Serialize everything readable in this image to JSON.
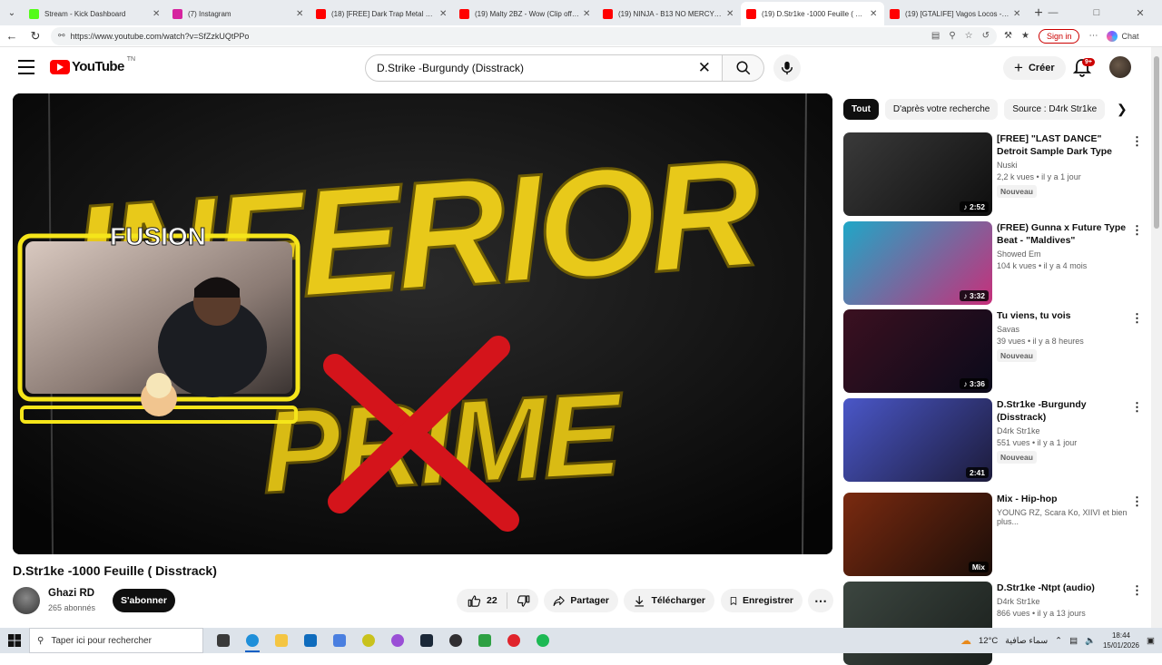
{
  "browser": {
    "tabs": [
      {
        "title": "Stream - Kick Dashboard",
        "favicon_color": "#53fc18",
        "active": false
      },
      {
        "title": "(7) Instagram",
        "favicon_color": "#d6249f",
        "active": false
      },
      {
        "title": "(18) [FREE] Dark Trap Metal Beat -",
        "favicon_color": "#ff0000",
        "active": false
      },
      {
        "title": "(19) Malty 2BZ - Wow (Clip officiel",
        "favicon_color": "#ff0000",
        "active": false
      },
      {
        "title": "(19) NINJA - B13 NO MERCY - You",
        "favicon_color": "#ff0000",
        "active": false
      },
      {
        "title": "(19) D.Str1ke -1000 Feuille ( Disstr",
        "favicon_color": "#ff0000",
        "active": true
      },
      {
        "title": "(19) [GTALIFE] Vagos Locos - Mon",
        "favicon_color": "#ff0000",
        "active": false
      }
    ],
    "url": "https://www.youtube.com/watch?v=SfZzkUQtPPo",
    "sign_in_label": "Sign in",
    "chat_label": "Chat"
  },
  "youtube": {
    "logo_text": "YouTube",
    "country_code": "TN",
    "search_query": "D.Strike -Burgundy (Disstrack)",
    "create_label": "Créer",
    "notif_badge": "9+"
  },
  "video": {
    "overlay_lines": [
      "INFERIOR",
      "PRIME"
    ],
    "cam_label": "FUSION",
    "title": "D.Str1ke -1000 Feuille ( Disstrack)",
    "channel": "Ghazi RD",
    "subscribers": "265 abonnés",
    "subscribe_label": "S'abonner",
    "likes": "22",
    "share_label": "Partager",
    "download_label": "Télécharger",
    "save_label": "Enregistrer"
  },
  "sidebar": {
    "chips": [
      "Tout",
      "D'après votre recherche",
      "Source : D4rk Str1ke"
    ],
    "recommendations": [
      {
        "title": "[FREE] \"LAST DANCE\" Detroit Sample Dark Type Beat | ...",
        "channel": "Nuski",
        "meta": "2,2 k vues • il y a 1 jour",
        "badge": "Nouveau",
        "duration": "2:52",
        "music": true,
        "thumb": [
          "#3a3a3a",
          "#0e0e0e"
        ]
      },
      {
        "title": "(FREE) Gunna x Future Type Beat - \"Maldives\"",
        "channel": "Showed Em",
        "meta": "104 k vues • il y a 4 mois",
        "badge": "",
        "duration": "3:32",
        "music": true,
        "thumb": [
          "#1fa7c7",
          "#c72f7a"
        ]
      },
      {
        "title": "Tu viens, tu vois",
        "channel": "Savas",
        "meta": "39 vues • il y a 8 heures",
        "badge": "Nouveau",
        "duration": "3:36",
        "music": true,
        "thumb": [
          "#3b1020",
          "#0a0a1a"
        ]
      },
      {
        "title": "D.Str1ke -Burgundy (Disstrack)",
        "channel": "D4rk Str1ke",
        "meta": "551 vues • il y a 1 jour",
        "badge": "Nouveau",
        "duration": "2:41",
        "music": false,
        "thumb": [
          "#4a57c8",
          "#1c1b3a"
        ]
      },
      {
        "title": "Mix - Hip-hop",
        "channel": "YOUNG RZ, Scara Ko, XIIVI et bien plus...",
        "meta": "",
        "badge": "",
        "duration": "Mix",
        "music": false,
        "thumb": [
          "#7a2a10",
          "#1a0d08"
        ]
      },
      {
        "title": "D.Str1ke -Ntpt (audio)",
        "channel": "D4rk Str1ke",
        "meta": "866 vues • il y a 13 jours",
        "badge": "",
        "duration": "",
        "music": false,
        "thumb": [
          "#3c4640",
          "#1a1f1c"
        ]
      }
    ]
  },
  "taskbar": {
    "search_placeholder": "Taper ici pour rechercher",
    "weather_temp": "12°C",
    "weather_text": "سماء صافية",
    "time": "18:44",
    "date": "15/01/2026",
    "apps": [
      "task-view",
      "edge",
      "file-explorer",
      "outlook",
      "store",
      "app-yellow",
      "app-purple",
      "steam",
      "obs",
      "app-green",
      "opera",
      "spotify"
    ]
  },
  "colors": {
    "accent_red": "#ff0000",
    "overlay_yellow": "#f2d21b",
    "subscribe_bg": "#0f0f0f"
  }
}
